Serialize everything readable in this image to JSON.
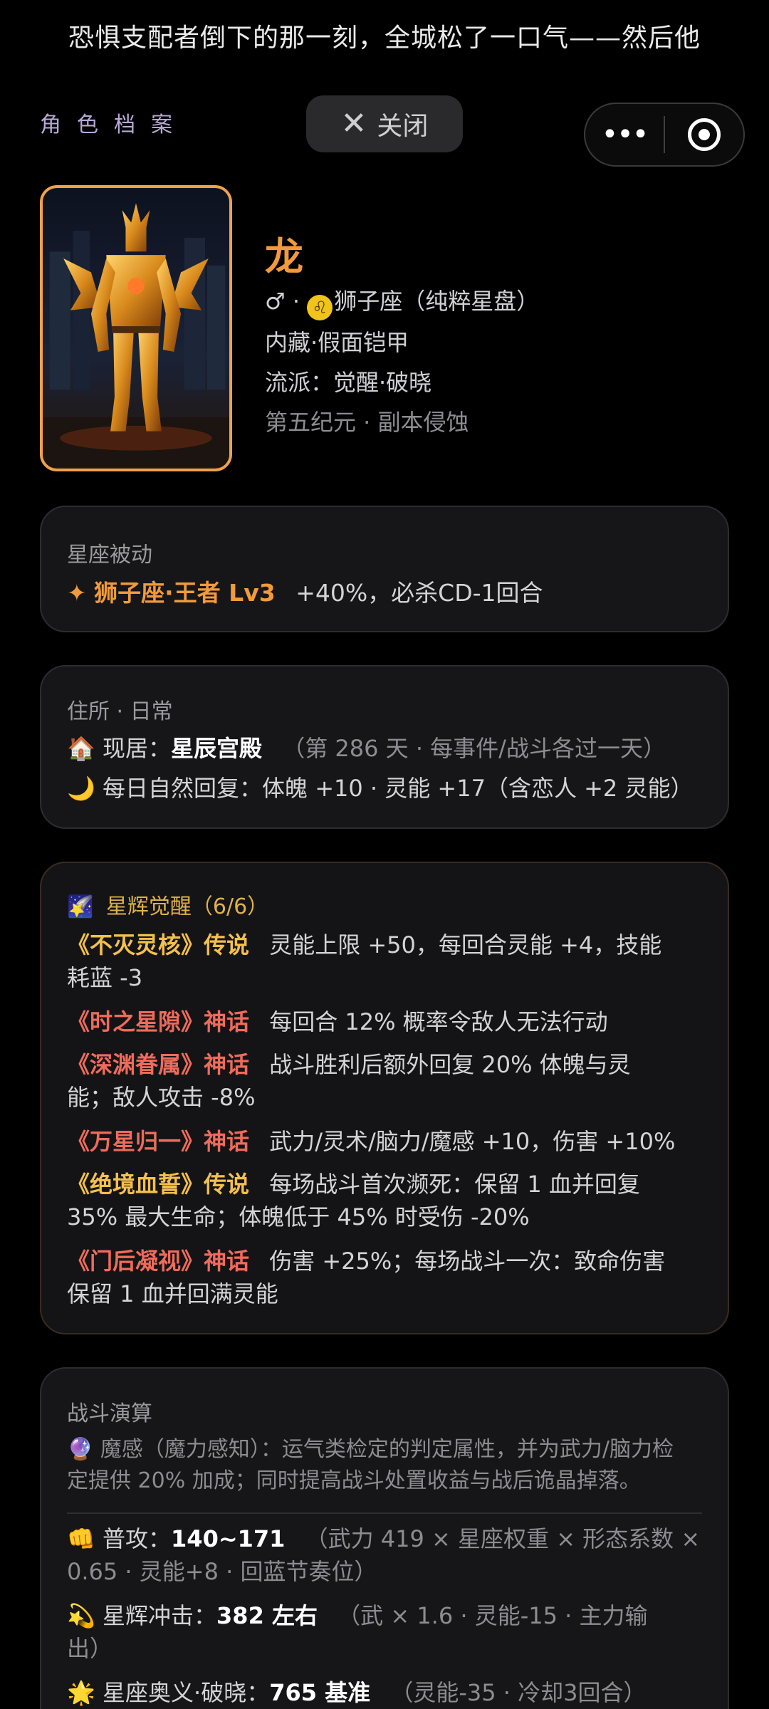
{
  "banner": {
    "text": "恐惧支配者倒下的那一刻，全城松了一口气——然后他"
  },
  "header": {
    "section_label": "角色档案",
    "close_label": "关闭",
    "close_icon": "close-x-icon",
    "more_icon": "more-dots-icon",
    "target_icon": "target-circle-icon"
  },
  "profile": {
    "name": "龙",
    "gender_symbol": "♂",
    "separator": " · ",
    "zodiac_symbol": "♌",
    "zodiac_text": "狮子座（纯粹星盘）",
    "hidden": "内藏·假面铠甲",
    "school": "流派：觉醒·破晓",
    "era": "第五纪元 · 副本侵蚀",
    "accent_color": "#f29a3a"
  },
  "passive": {
    "title": "星座被动",
    "star": "✦",
    "skill": "狮子座·王者 Lv3",
    "effect": "+40%，必杀CD-1回合"
  },
  "residence": {
    "title": "住所 · 日常",
    "home_icon": "🏠",
    "home_label": "现居：",
    "home_name": "星辰宫殿",
    "home_note": "（第 286 天 · 每事件/战斗各过一天）",
    "moon_icon": "🌙",
    "recovery": "每日自然回复：体魄 +10 · 灵能 +17（含恋人 +2 灵能）"
  },
  "awakening": {
    "icon": "🌠",
    "title": "星辉觉醒（6/6）",
    "items": [
      {
        "name": "《不灭灵核》传说",
        "desc1": "灵能上限 +50，每回合灵能 +4，技能",
        "desc2": "耗蓝 -3"
      },
      {
        "name": "《时之星隙》神话",
        "desc1": "每回合 12% 概率令敌人无法行动",
        "desc2": ""
      },
      {
        "name": "《深渊眷属》神话",
        "desc1": "战斗胜利后额外回复 20% 体魄与灵",
        "desc2": "能；敌人攻击 -8%"
      },
      {
        "name": "《万星归一》神话",
        "desc1": "武力/灵术/脑力/魔感 +10，伤害 +10%",
        "desc2": ""
      },
      {
        "name": "《绝境血誓》传说",
        "desc1": "每场战斗首次濒死：保留 1 血并回复",
        "desc2": "35% 最大生命；体魄低于 45% 时受伤 -20%"
      },
      {
        "name": "《门后凝视》神话",
        "desc1": "伤害 +25%；每场战斗一次：致命伤害",
        "desc2": "保留 1 血并回满灵能"
      }
    ]
  },
  "combat": {
    "title": "战斗演算",
    "magic_icon": "🔮",
    "magic_line1": "魔感（魔力感知）：运气类检定的判定属性，并为武力/脑力检",
    "magic_line2": "定提供 20% 加成；同时提高战斗处置收益与战后诡晶掉落。",
    "attack_icon": "👊",
    "attack_label": "普攻：",
    "attack_value": "140~171",
    "attack_note1": "（武力 419 × 星座权重 × 形态系数 ×",
    "attack_note2": "0.65 · 灵能+8 · 回蓝节奏位）",
    "impact_icon": "💫",
    "impact_label": "星辉冲击：",
    "impact_value": "382 左右",
    "impact_note1": "（武 × 1.6 · 灵能-15 · 主力输",
    "impact_note2": "出）",
    "ult_icon": "🌟",
    "ult_label": "星座奥义·破晓：",
    "ult_value": "765 基准",
    "ult_note": "（灵能-35 · 冷却3回合）"
  }
}
